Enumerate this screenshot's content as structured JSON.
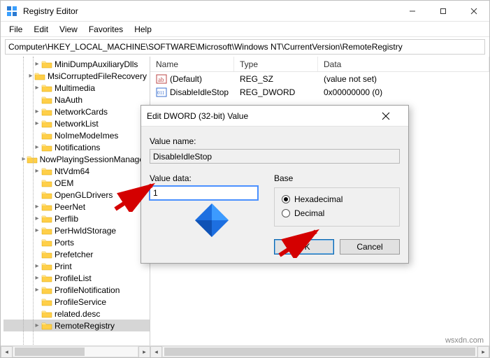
{
  "window": {
    "title": "Registry Editor",
    "iconName": "regedit-icon"
  },
  "menu": {
    "items": [
      "File",
      "Edit",
      "View",
      "Favorites",
      "Help"
    ]
  },
  "address": "Computer\\HKEY_LOCAL_MACHINE\\SOFTWARE\\Microsoft\\Windows NT\\CurrentVersion\\RemoteRegistry",
  "treeItems": [
    {
      "label": "MiniDumpAuxiliaryDlls",
      "expandable": true
    },
    {
      "label": "MsiCorruptedFileRecovery",
      "expandable": true
    },
    {
      "label": "Multimedia",
      "expandable": true
    },
    {
      "label": "NaAuth",
      "expandable": false
    },
    {
      "label": "NetworkCards",
      "expandable": true
    },
    {
      "label": "NetworkList",
      "expandable": true
    },
    {
      "label": "NoImeModeImes",
      "expandable": false
    },
    {
      "label": "Notifications",
      "expandable": true
    },
    {
      "label": "NowPlayingSessionManager",
      "expandable": true
    },
    {
      "label": "NtVdm64",
      "expandable": true
    },
    {
      "label": "OEM",
      "expandable": false
    },
    {
      "label": "OpenGLDrivers",
      "expandable": false
    },
    {
      "label": "PeerNet",
      "expandable": true
    },
    {
      "label": "Perflib",
      "expandable": true
    },
    {
      "label": "PerHwIdStorage",
      "expandable": true
    },
    {
      "label": "Ports",
      "expandable": false
    },
    {
      "label": "Prefetcher",
      "expandable": false
    },
    {
      "label": "Print",
      "expandable": true
    },
    {
      "label": "ProfileList",
      "expandable": true
    },
    {
      "label": "ProfileNotification",
      "expandable": true
    },
    {
      "label": "ProfileService",
      "expandable": false
    },
    {
      "label": "related.desc",
      "expandable": false
    },
    {
      "label": "RemoteRegistry",
      "expandable": true,
      "selected": true
    }
  ],
  "list": {
    "columns": {
      "name": "Name",
      "type": "Type",
      "data": "Data"
    },
    "rows": [
      {
        "icon": "string-icon",
        "name": "(Default)",
        "type": "REG_SZ",
        "data": "(value not set)"
      },
      {
        "icon": "dword-icon",
        "name": "DisableIdleStop",
        "type": "REG_DWORD",
        "data": "0x00000000 (0)"
      }
    ]
  },
  "dialog": {
    "title": "Edit DWORD (32-bit) Value",
    "valueNameLabel": "Value name:",
    "valueName": "DisableIdleStop",
    "valueDataLabel": "Value data:",
    "valueData": "1",
    "baseGroup": {
      "title": "Base",
      "options": [
        {
          "label": "Hexadecimal",
          "checked": true
        },
        {
          "label": "Decimal",
          "checked": false
        }
      ]
    },
    "okLabel": "OK",
    "cancelLabel": "Cancel"
  },
  "watermark": "wsxdn.com"
}
